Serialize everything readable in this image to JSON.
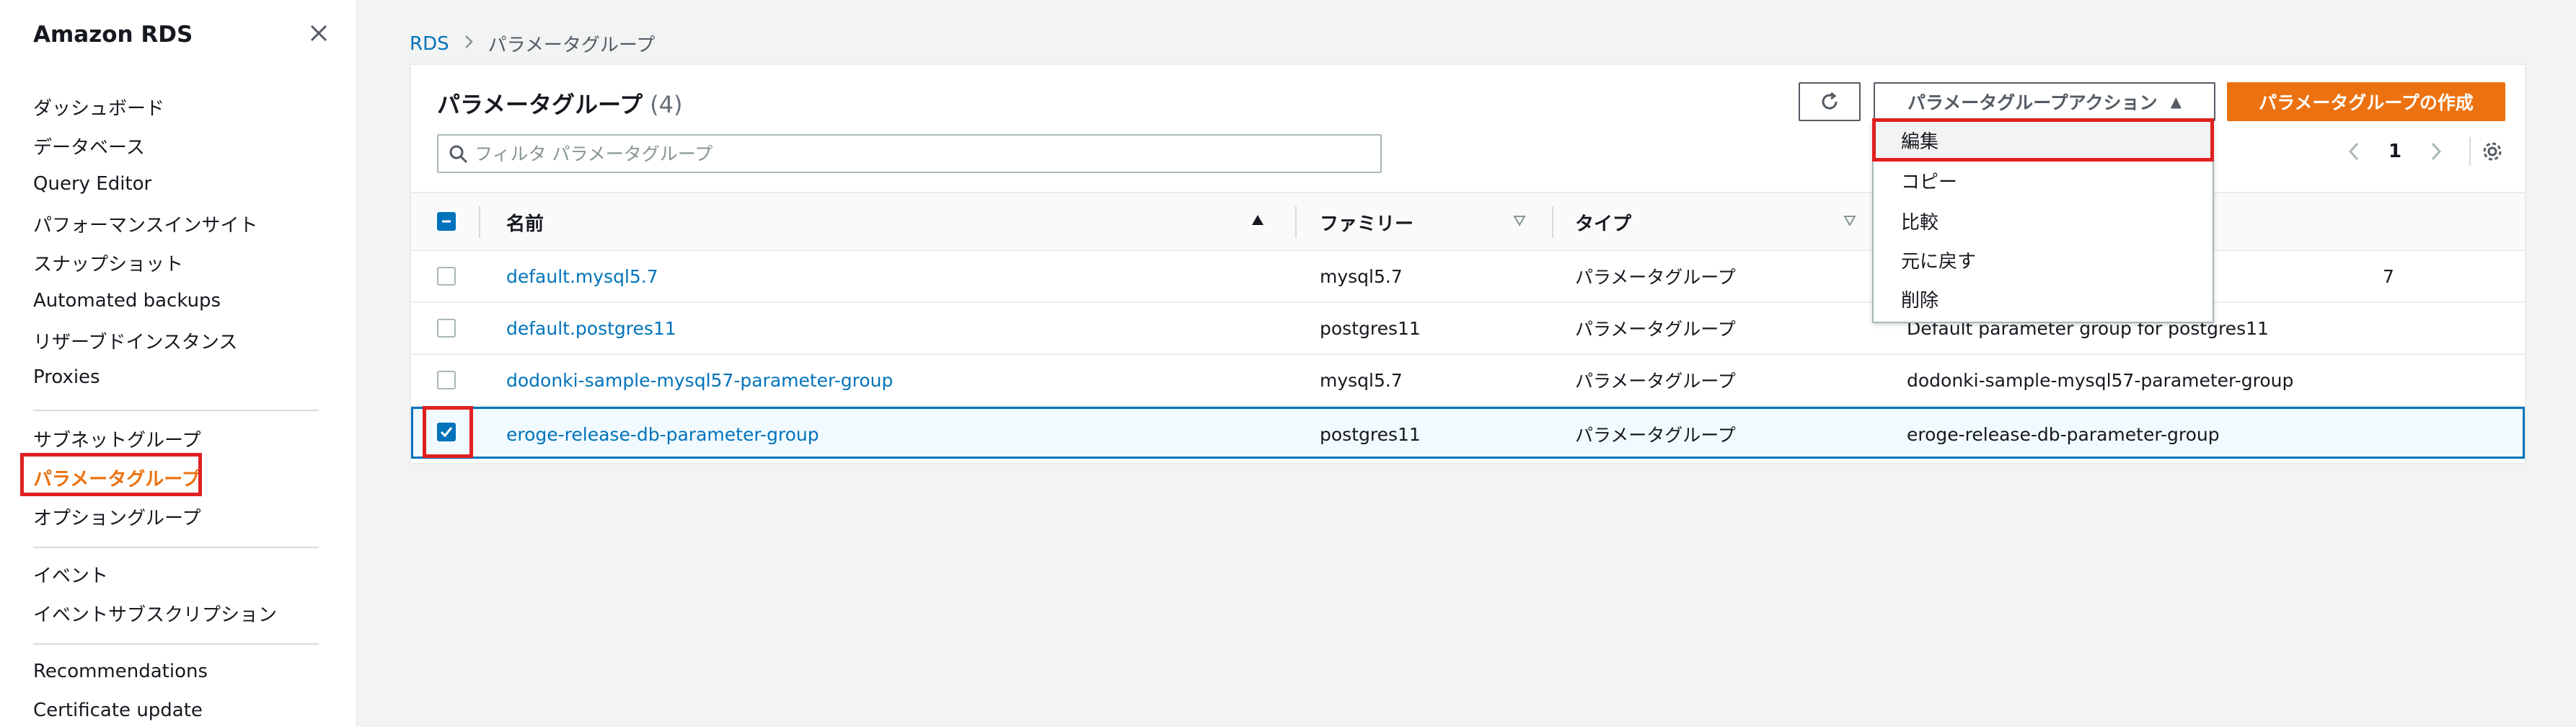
{
  "sidebar": {
    "title": "Amazon RDS",
    "group1": [
      "ダッシュボード",
      "データベース",
      "Query Editor",
      "パフォーマンスインサイト",
      "スナップショット",
      "Automated backups",
      "リザーブドインスタンス",
      "Proxies"
    ],
    "group2": [
      "サブネットグループ",
      "パラメータグループ",
      "オプショングループ"
    ],
    "group3": [
      "イベント",
      "イベントサブスクリプション"
    ],
    "group4": [
      "Recommendations",
      "Certificate update"
    ]
  },
  "breadcrumb": {
    "root": "RDS",
    "current": "パラメータグループ"
  },
  "panel": {
    "title": "パラメータグループ",
    "count": "(4)",
    "search_placeholder": "フィルタ パラメータグループ",
    "actions_label": "パラメータグループアクション",
    "create_label": "パラメータグループの作成",
    "page": "1"
  },
  "table": {
    "headers": {
      "name": "名前",
      "family": "ファミリー",
      "type": "タイプ"
    },
    "rows": [
      {
        "name": "default.mysql5.7",
        "family": "mysql5.7",
        "type": "パラメータグループ",
        "description": "7"
      },
      {
        "name": "default.postgres11",
        "family": "postgres11",
        "type": "パラメータグループ",
        "description": "Default parameter group for postgres11"
      },
      {
        "name": "dodonki-sample-mysql57-parameter-group",
        "family": "mysql5.7",
        "type": "パラメータグループ",
        "description": "dodonki-sample-mysql57-parameter-group"
      },
      {
        "name": "eroge-release-db-parameter-group",
        "family": "postgres11",
        "type": "パラメータグループ",
        "description": "eroge-release-db-parameter-group"
      }
    ]
  },
  "dropdown": {
    "items": [
      "編集",
      "コピー",
      "比較",
      "元に戻す",
      "削除"
    ]
  },
  "colors": {
    "accent": "#ec7211",
    "link": "#0073bb",
    "highlight_box": "#e02020"
  }
}
